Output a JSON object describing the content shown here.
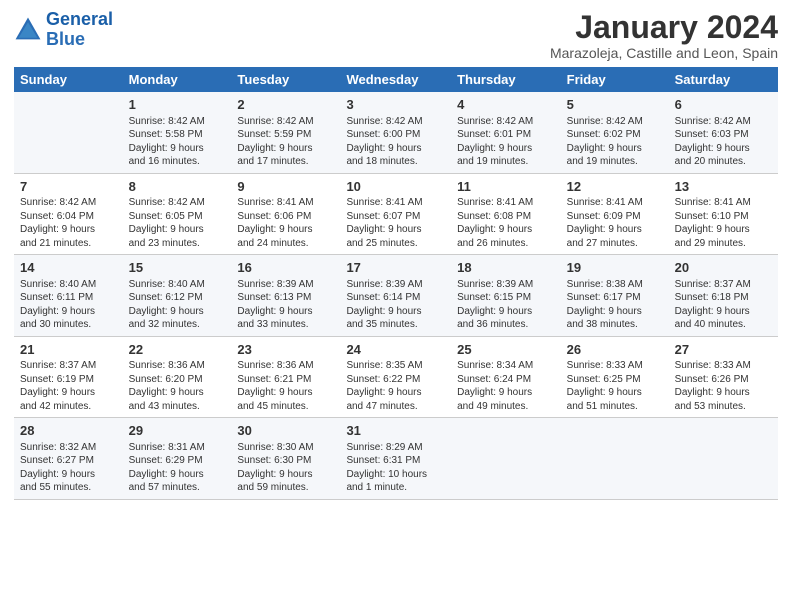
{
  "header": {
    "logo_line1": "General",
    "logo_line2": "Blue",
    "month": "January 2024",
    "location": "Marazoleja, Castille and Leon, Spain"
  },
  "weekdays": [
    "Sunday",
    "Monday",
    "Tuesday",
    "Wednesday",
    "Thursday",
    "Friday",
    "Saturday"
  ],
  "weeks": [
    [
      {
        "day": "",
        "info": ""
      },
      {
        "day": "1",
        "info": "Sunrise: 8:42 AM\nSunset: 5:58 PM\nDaylight: 9 hours\nand 16 minutes."
      },
      {
        "day": "2",
        "info": "Sunrise: 8:42 AM\nSunset: 5:59 PM\nDaylight: 9 hours\nand 17 minutes."
      },
      {
        "day": "3",
        "info": "Sunrise: 8:42 AM\nSunset: 6:00 PM\nDaylight: 9 hours\nand 18 minutes."
      },
      {
        "day": "4",
        "info": "Sunrise: 8:42 AM\nSunset: 6:01 PM\nDaylight: 9 hours\nand 19 minutes."
      },
      {
        "day": "5",
        "info": "Sunrise: 8:42 AM\nSunset: 6:02 PM\nDaylight: 9 hours\nand 19 minutes."
      },
      {
        "day": "6",
        "info": "Sunrise: 8:42 AM\nSunset: 6:03 PM\nDaylight: 9 hours\nand 20 minutes."
      }
    ],
    [
      {
        "day": "7",
        "info": "Sunrise: 8:42 AM\nSunset: 6:04 PM\nDaylight: 9 hours\nand 21 minutes."
      },
      {
        "day": "8",
        "info": "Sunrise: 8:42 AM\nSunset: 6:05 PM\nDaylight: 9 hours\nand 23 minutes."
      },
      {
        "day": "9",
        "info": "Sunrise: 8:41 AM\nSunset: 6:06 PM\nDaylight: 9 hours\nand 24 minutes."
      },
      {
        "day": "10",
        "info": "Sunrise: 8:41 AM\nSunset: 6:07 PM\nDaylight: 9 hours\nand 25 minutes."
      },
      {
        "day": "11",
        "info": "Sunrise: 8:41 AM\nSunset: 6:08 PM\nDaylight: 9 hours\nand 26 minutes."
      },
      {
        "day": "12",
        "info": "Sunrise: 8:41 AM\nSunset: 6:09 PM\nDaylight: 9 hours\nand 27 minutes."
      },
      {
        "day": "13",
        "info": "Sunrise: 8:41 AM\nSunset: 6:10 PM\nDaylight: 9 hours\nand 29 minutes."
      }
    ],
    [
      {
        "day": "14",
        "info": "Sunrise: 8:40 AM\nSunset: 6:11 PM\nDaylight: 9 hours\nand 30 minutes."
      },
      {
        "day": "15",
        "info": "Sunrise: 8:40 AM\nSunset: 6:12 PM\nDaylight: 9 hours\nand 32 minutes."
      },
      {
        "day": "16",
        "info": "Sunrise: 8:39 AM\nSunset: 6:13 PM\nDaylight: 9 hours\nand 33 minutes."
      },
      {
        "day": "17",
        "info": "Sunrise: 8:39 AM\nSunset: 6:14 PM\nDaylight: 9 hours\nand 35 minutes."
      },
      {
        "day": "18",
        "info": "Sunrise: 8:39 AM\nSunset: 6:15 PM\nDaylight: 9 hours\nand 36 minutes."
      },
      {
        "day": "19",
        "info": "Sunrise: 8:38 AM\nSunset: 6:17 PM\nDaylight: 9 hours\nand 38 minutes."
      },
      {
        "day": "20",
        "info": "Sunrise: 8:37 AM\nSunset: 6:18 PM\nDaylight: 9 hours\nand 40 minutes."
      }
    ],
    [
      {
        "day": "21",
        "info": "Sunrise: 8:37 AM\nSunset: 6:19 PM\nDaylight: 9 hours\nand 42 minutes."
      },
      {
        "day": "22",
        "info": "Sunrise: 8:36 AM\nSunset: 6:20 PM\nDaylight: 9 hours\nand 43 minutes."
      },
      {
        "day": "23",
        "info": "Sunrise: 8:36 AM\nSunset: 6:21 PM\nDaylight: 9 hours\nand 45 minutes."
      },
      {
        "day": "24",
        "info": "Sunrise: 8:35 AM\nSunset: 6:22 PM\nDaylight: 9 hours\nand 47 minutes."
      },
      {
        "day": "25",
        "info": "Sunrise: 8:34 AM\nSunset: 6:24 PM\nDaylight: 9 hours\nand 49 minutes."
      },
      {
        "day": "26",
        "info": "Sunrise: 8:33 AM\nSunset: 6:25 PM\nDaylight: 9 hours\nand 51 minutes."
      },
      {
        "day": "27",
        "info": "Sunrise: 8:33 AM\nSunset: 6:26 PM\nDaylight: 9 hours\nand 53 minutes."
      }
    ],
    [
      {
        "day": "28",
        "info": "Sunrise: 8:32 AM\nSunset: 6:27 PM\nDaylight: 9 hours\nand 55 minutes."
      },
      {
        "day": "29",
        "info": "Sunrise: 8:31 AM\nSunset: 6:29 PM\nDaylight: 9 hours\nand 57 minutes."
      },
      {
        "day": "30",
        "info": "Sunrise: 8:30 AM\nSunset: 6:30 PM\nDaylight: 9 hours\nand 59 minutes."
      },
      {
        "day": "31",
        "info": "Sunrise: 8:29 AM\nSunset: 6:31 PM\nDaylight: 10 hours\nand 1 minute."
      },
      {
        "day": "",
        "info": ""
      },
      {
        "day": "",
        "info": ""
      },
      {
        "day": "",
        "info": ""
      }
    ]
  ]
}
